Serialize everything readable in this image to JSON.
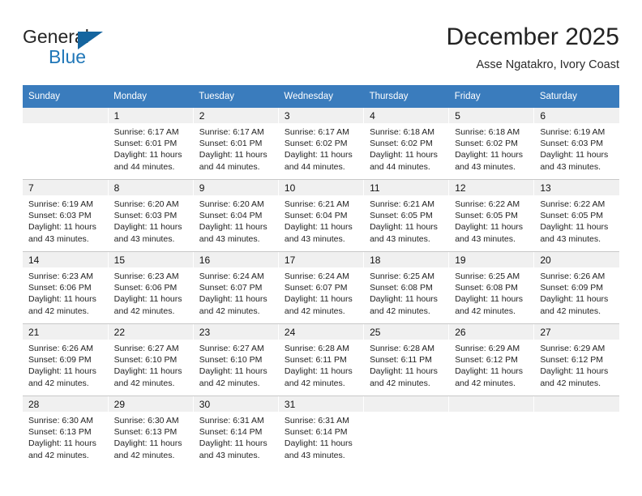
{
  "brand": {
    "name_top": "General",
    "name_bottom": "Blue",
    "color_dark": "#262626",
    "color_blue": "#2077b8",
    "triangle_color": "#15659f"
  },
  "header": {
    "title": "December 2025",
    "subtitle": "Asse Ngatakro, Ivory Coast"
  },
  "theme": {
    "header_band": "#3a7cbd",
    "daynum_band": "#f0f0f0",
    "grid_line": "#c8c8c8",
    "text": "#232323"
  },
  "weekdays": [
    "Sunday",
    "Monday",
    "Tuesday",
    "Wednesday",
    "Thursday",
    "Friday",
    "Saturday"
  ],
  "weeks": [
    [
      {
        "day": "",
        "lines": []
      },
      {
        "day": "1",
        "lines": [
          "Sunrise: 6:17 AM",
          "Sunset: 6:01 PM",
          "Daylight: 11 hours",
          "and 44 minutes."
        ]
      },
      {
        "day": "2",
        "lines": [
          "Sunrise: 6:17 AM",
          "Sunset: 6:01 PM",
          "Daylight: 11 hours",
          "and 44 minutes."
        ]
      },
      {
        "day": "3",
        "lines": [
          "Sunrise: 6:17 AM",
          "Sunset: 6:02 PM",
          "Daylight: 11 hours",
          "and 44 minutes."
        ]
      },
      {
        "day": "4",
        "lines": [
          "Sunrise: 6:18 AM",
          "Sunset: 6:02 PM",
          "Daylight: 11 hours",
          "and 44 minutes."
        ]
      },
      {
        "day": "5",
        "lines": [
          "Sunrise: 6:18 AM",
          "Sunset: 6:02 PM",
          "Daylight: 11 hours",
          "and 43 minutes."
        ]
      },
      {
        "day": "6",
        "lines": [
          "Sunrise: 6:19 AM",
          "Sunset: 6:03 PM",
          "Daylight: 11 hours",
          "and 43 minutes."
        ]
      }
    ],
    [
      {
        "day": "7",
        "lines": [
          "Sunrise: 6:19 AM",
          "Sunset: 6:03 PM",
          "Daylight: 11 hours",
          "and 43 minutes."
        ]
      },
      {
        "day": "8",
        "lines": [
          "Sunrise: 6:20 AM",
          "Sunset: 6:03 PM",
          "Daylight: 11 hours",
          "and 43 minutes."
        ]
      },
      {
        "day": "9",
        "lines": [
          "Sunrise: 6:20 AM",
          "Sunset: 6:04 PM",
          "Daylight: 11 hours",
          "and 43 minutes."
        ]
      },
      {
        "day": "10",
        "lines": [
          "Sunrise: 6:21 AM",
          "Sunset: 6:04 PM",
          "Daylight: 11 hours",
          "and 43 minutes."
        ]
      },
      {
        "day": "11",
        "lines": [
          "Sunrise: 6:21 AM",
          "Sunset: 6:05 PM",
          "Daylight: 11 hours",
          "and 43 minutes."
        ]
      },
      {
        "day": "12",
        "lines": [
          "Sunrise: 6:22 AM",
          "Sunset: 6:05 PM",
          "Daylight: 11 hours",
          "and 43 minutes."
        ]
      },
      {
        "day": "13",
        "lines": [
          "Sunrise: 6:22 AM",
          "Sunset: 6:05 PM",
          "Daylight: 11 hours",
          "and 43 minutes."
        ]
      }
    ],
    [
      {
        "day": "14",
        "lines": [
          "Sunrise: 6:23 AM",
          "Sunset: 6:06 PM",
          "Daylight: 11 hours",
          "and 42 minutes."
        ]
      },
      {
        "day": "15",
        "lines": [
          "Sunrise: 6:23 AM",
          "Sunset: 6:06 PM",
          "Daylight: 11 hours",
          "and 42 minutes."
        ]
      },
      {
        "day": "16",
        "lines": [
          "Sunrise: 6:24 AM",
          "Sunset: 6:07 PM",
          "Daylight: 11 hours",
          "and 42 minutes."
        ]
      },
      {
        "day": "17",
        "lines": [
          "Sunrise: 6:24 AM",
          "Sunset: 6:07 PM",
          "Daylight: 11 hours",
          "and 42 minutes."
        ]
      },
      {
        "day": "18",
        "lines": [
          "Sunrise: 6:25 AM",
          "Sunset: 6:08 PM",
          "Daylight: 11 hours",
          "and 42 minutes."
        ]
      },
      {
        "day": "19",
        "lines": [
          "Sunrise: 6:25 AM",
          "Sunset: 6:08 PM",
          "Daylight: 11 hours",
          "and 42 minutes."
        ]
      },
      {
        "day": "20",
        "lines": [
          "Sunrise: 6:26 AM",
          "Sunset: 6:09 PM",
          "Daylight: 11 hours",
          "and 42 minutes."
        ]
      }
    ],
    [
      {
        "day": "21",
        "lines": [
          "Sunrise: 6:26 AM",
          "Sunset: 6:09 PM",
          "Daylight: 11 hours",
          "and 42 minutes."
        ]
      },
      {
        "day": "22",
        "lines": [
          "Sunrise: 6:27 AM",
          "Sunset: 6:10 PM",
          "Daylight: 11 hours",
          "and 42 minutes."
        ]
      },
      {
        "day": "23",
        "lines": [
          "Sunrise: 6:27 AM",
          "Sunset: 6:10 PM",
          "Daylight: 11 hours",
          "and 42 minutes."
        ]
      },
      {
        "day": "24",
        "lines": [
          "Sunrise: 6:28 AM",
          "Sunset: 6:11 PM",
          "Daylight: 11 hours",
          "and 42 minutes."
        ]
      },
      {
        "day": "25",
        "lines": [
          "Sunrise: 6:28 AM",
          "Sunset: 6:11 PM",
          "Daylight: 11 hours",
          "and 42 minutes."
        ]
      },
      {
        "day": "26",
        "lines": [
          "Sunrise: 6:29 AM",
          "Sunset: 6:12 PM",
          "Daylight: 11 hours",
          "and 42 minutes."
        ]
      },
      {
        "day": "27",
        "lines": [
          "Sunrise: 6:29 AM",
          "Sunset: 6:12 PM",
          "Daylight: 11 hours",
          "and 42 minutes."
        ]
      }
    ],
    [
      {
        "day": "28",
        "lines": [
          "Sunrise: 6:30 AM",
          "Sunset: 6:13 PM",
          "Daylight: 11 hours",
          "and 42 minutes."
        ]
      },
      {
        "day": "29",
        "lines": [
          "Sunrise: 6:30 AM",
          "Sunset: 6:13 PM",
          "Daylight: 11 hours",
          "and 42 minutes."
        ]
      },
      {
        "day": "30",
        "lines": [
          "Sunrise: 6:31 AM",
          "Sunset: 6:14 PM",
          "Daylight: 11 hours",
          "and 43 minutes."
        ]
      },
      {
        "day": "31",
        "lines": [
          "Sunrise: 6:31 AM",
          "Sunset: 6:14 PM",
          "Daylight: 11 hours",
          "and 43 minutes."
        ]
      },
      {
        "day": "",
        "lines": []
      },
      {
        "day": "",
        "lines": []
      },
      {
        "day": "",
        "lines": []
      }
    ]
  ]
}
